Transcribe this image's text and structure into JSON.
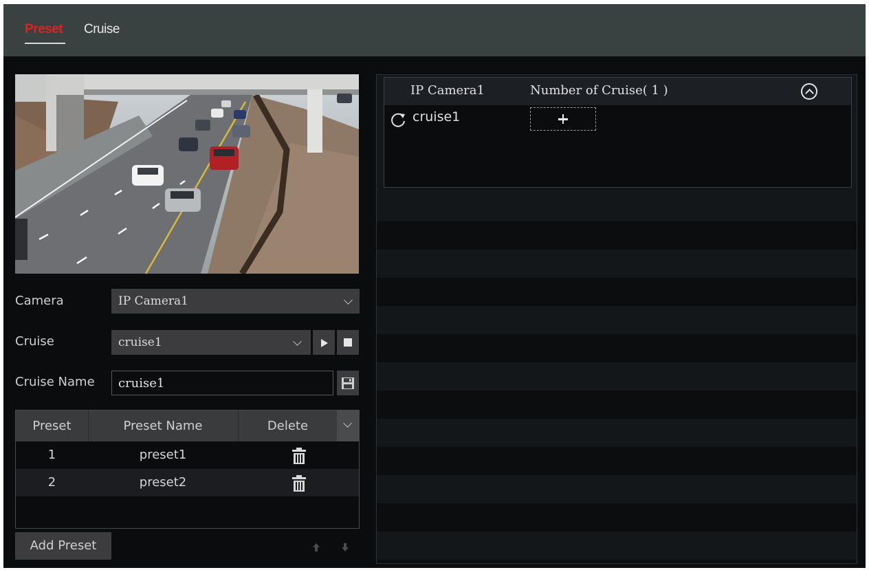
{
  "tabs": [
    {
      "label": "Preset",
      "active": true
    },
    {
      "label": "Cruise",
      "active": false
    }
  ],
  "form": {
    "camera_label": "Camera",
    "camera_value": "IP Camera1",
    "cruise_label": "Cruise",
    "cruise_value": "cruise1",
    "cruise_name_label": "Cruise Name",
    "cruise_name_value": "cruise1"
  },
  "preset_table": {
    "columns": [
      "Preset",
      "Preset Name",
      "Delete"
    ],
    "rows": [
      {
        "preset": "1",
        "name": "preset1"
      },
      {
        "preset": "2",
        "name": "preset2"
      }
    ]
  },
  "buttons": {
    "add_preset": "Add Preset"
  },
  "cruise_panel": {
    "camera": "IP Camera1",
    "count_label": "Number of Cruise( 1 )",
    "items": [
      {
        "name": "cruise1"
      }
    ]
  },
  "icons": {
    "play": "play-icon",
    "stop": "stop-icon",
    "save": "save-icon",
    "trash": "trash-icon",
    "collapse": "collapse-up-icon",
    "cruise": "refresh-icon",
    "add": "plus-icon",
    "move_up": "arrow-up-icon",
    "move_down": "arrow-down-icon"
  },
  "colors": {
    "active_tab": "#e0221e",
    "header_bg": "#3a4141",
    "panel_bg": "#0b0c0e",
    "control_bg": "#3c3c3f"
  }
}
